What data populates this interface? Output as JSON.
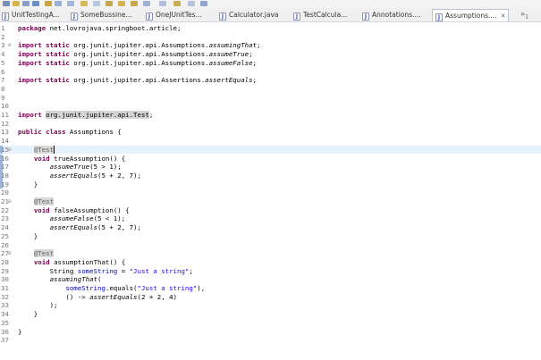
{
  "tabs": [
    {
      "label": "UnitTestingA...",
      "icon": "java-file-icon"
    },
    {
      "label": "SomeBussine...",
      "icon": "java-file-icon"
    },
    {
      "label": "OneJUnitTes...",
      "icon": "java-file-icon"
    },
    {
      "label": "Calculator.java",
      "icon": "java-file-icon"
    },
    {
      "label": "TestCalcula...",
      "icon": "java-file-icon"
    },
    {
      "label": "Annotations....",
      "icon": "java-file-icon"
    },
    {
      "label": "Assumptions....",
      "icon": "java-file-icon",
      "active": true,
      "close": "✕"
    }
  ],
  "overflow": {
    "symbol": "»",
    "count": "1"
  },
  "code_lines": [
    {
      "num": "1",
      "fold": "",
      "html": "<span class=\"kw\">package</span> net.lovrojava.springboot.article;"
    },
    {
      "num": "2",
      "fold": "",
      "html": ""
    },
    {
      "num": "3",
      "fold": "⊖",
      "html": "<span class=\"kw\">import</span> <span class=\"kw\">static</span> org.junit.jupiter.api.Assumptions.<span class=\"it\">assumingThat</span>;"
    },
    {
      "num": "4",
      "fold": "",
      "html": "<span class=\"kw\">import</span> <span class=\"kw\">static</span> org.junit.jupiter.api.Assumptions.<span class=\"it\">assumeTrue</span>;"
    },
    {
      "num": "5",
      "fold": "",
      "html": "<span class=\"kw\">import</span> <span class=\"kw\">static</span> org.junit.jupiter.api.Assumptions.<span class=\"it\">assumeFalse</span>;"
    },
    {
      "num": "6",
      "fold": "",
      "html": ""
    },
    {
      "num": "7",
      "fold": "",
      "html": "<span class=\"kw\">import</span> <span class=\"kw\">static</span> org.junit.jupiter.api.Assertions.<span class=\"it\">assertEquals</span>;"
    },
    {
      "num": "8",
      "fold": "",
      "html": ""
    },
    {
      "num": "9",
      "fold": "",
      "html": ""
    },
    {
      "num": "10",
      "fold": "",
      "html": ""
    },
    {
      "num": "11",
      "fold": "",
      "html": "<span class=\"kw\">import</span> <span class=\"hl\">org.junit.jupiter.api.Test</span>;"
    },
    {
      "num": "12",
      "fold": "",
      "html": ""
    },
    {
      "num": "13",
      "fold": "",
      "html": "<span class=\"kw\">public</span> <span class=\"kw\">class</span> Assumptions {"
    },
    {
      "num": "14",
      "fold": "",
      "html": ""
    },
    {
      "num": "15",
      "fold": "⊖",
      "html": "    <span class=\"an ann-hl\">@Test</span><span class=\"caret\"></span>",
      "current": true
    },
    {
      "num": "16",
      "fold": "",
      "html": "    <span class=\"kw\">void</span> trueAssumption() {"
    },
    {
      "num": "17",
      "fold": "",
      "html": "        <span class=\"it\">assumeTrue</span>(5 &gt; 1);"
    },
    {
      "num": "18",
      "fold": "",
      "html": "        <span class=\"it\">assertEquals</span>(5 + 2, 7);"
    },
    {
      "num": "19",
      "fold": "",
      "html": "    }"
    },
    {
      "num": "20",
      "fold": "",
      "html": ""
    },
    {
      "num": "21",
      "fold": "⊖",
      "html": "    <span class=\"an ann-hl\">@Test</span>"
    },
    {
      "num": "22",
      "fold": "",
      "html": "    <span class=\"kw\">void</span> falseAssumption() {"
    },
    {
      "num": "23",
      "fold": "",
      "html": "        <span class=\"it\">assumeFalse</span>(5 &lt; 1);"
    },
    {
      "num": "24",
      "fold": "",
      "html": "        <span class=\"it\">assertEquals</span>(5 + 2, 7);"
    },
    {
      "num": "25",
      "fold": "",
      "html": "    }"
    },
    {
      "num": "26",
      "fold": "",
      "html": ""
    },
    {
      "num": "27",
      "fold": "⊖",
      "html": "    <span class=\"an ann-hl\">@Test</span>"
    },
    {
      "num": "28",
      "fold": "",
      "html": "    <span class=\"kw\">void</span> assumptionThat() {"
    },
    {
      "num": "29",
      "fold": "",
      "html": "        String <span class=\"fld\">someString</span> = <span class=\"st\">\"Just a string\"</span>;"
    },
    {
      "num": "30",
      "fold": "",
      "html": "        <span class=\"it\">assumingThat</span>("
    },
    {
      "num": "31",
      "fold": "",
      "html": "            <span class=\"fld\">someString</span>.equals(<span class=\"st\">\"Just a string\"</span>),"
    },
    {
      "num": "32",
      "fold": "",
      "html": "            () -&gt; <span class=\"it\">assertEquals</span>(2 + 2, 4)"
    },
    {
      "num": "33",
      "fold": "",
      "html": "        );"
    },
    {
      "num": "34",
      "fold": "",
      "html": "    }"
    },
    {
      "num": "35",
      "fold": "",
      "html": ""
    },
    {
      "num": "36",
      "fold": "",
      "html": "}"
    },
    {
      "num": "37",
      "fold": "",
      "html": ""
    }
  ]
}
